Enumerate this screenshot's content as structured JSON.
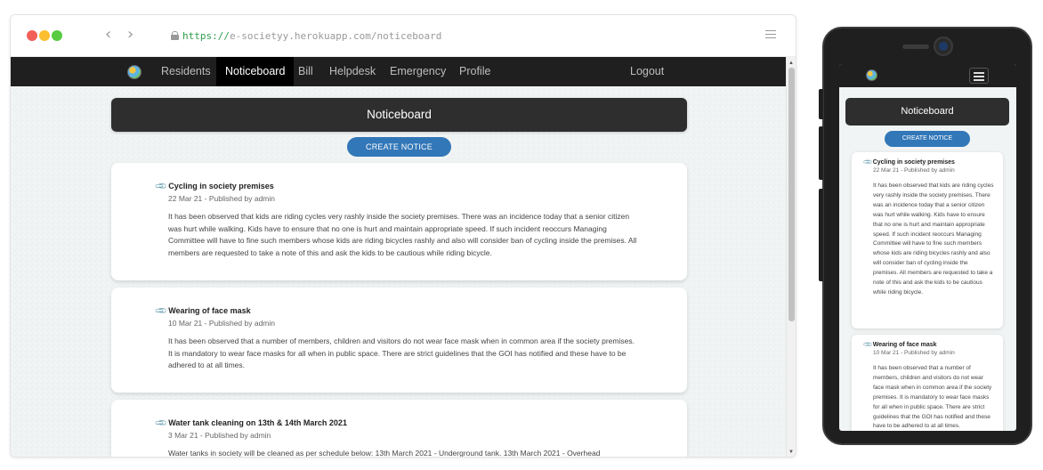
{
  "browser": {
    "url_scheme": "https://",
    "url_rest": "e-societyy.herokuapp.com/noticeboard",
    "back_glyph": "‹",
    "forward_glyph": "›"
  },
  "nav": {
    "items": [
      {
        "label": "Residents"
      },
      {
        "label": "Noticeboard",
        "active": true
      },
      {
        "label": "Bill"
      },
      {
        "label": "Helpdesk"
      },
      {
        "label": "Emergency"
      },
      {
        "label": "Profile"
      }
    ],
    "logout_label": "Logout"
  },
  "page": {
    "title": "Noticeboard",
    "create_button_label": "CREATE NOTICE"
  },
  "notices": [
    {
      "title": "Cycling in society premises",
      "meta": "22 Mar 21 - Published by admin",
      "body": "It has been observed that kids are riding cycles very rashly inside the society premises. There was an incidence today that a senior citizen was hurt while walking. Kids have to ensure that no one is hurt and maintain appropriate speed. If such incident reoccurs Managing Committee will have to fine such members whose kids are riding bicycles rashly and also will consider ban of cycling inside the premises. All members are requested to take a note of this and ask the kids to be cautious while riding bicycle."
    },
    {
      "title": "Wearing of face mask",
      "meta": "10 Mar 21 - Published by admin",
      "body": "It has been observed that a number of members, children and visitors do not wear face mask when in common area if the society premises. It is mandatory to wear face masks for all when in public space. There are strict guidelines that the GOI has notified and these have to be adhered to at all times."
    },
    {
      "title": "Water tank cleaning on 13th & 14th March 2021",
      "meta": "3 Mar 21 - Published by admin",
      "body": "Water tanks in society will be cleaned as per schedule below: 13th March 2021 - Underground tank. 13th March 2021 - Overhead"
    }
  ],
  "icons": {
    "clip": "📎",
    "scroll_up": "▲",
    "scroll_down": "▼"
  },
  "colors": {
    "navbar": "#1f1f1f",
    "accent_button": "#3277b8",
    "header_panel": "#2e2e2e"
  }
}
